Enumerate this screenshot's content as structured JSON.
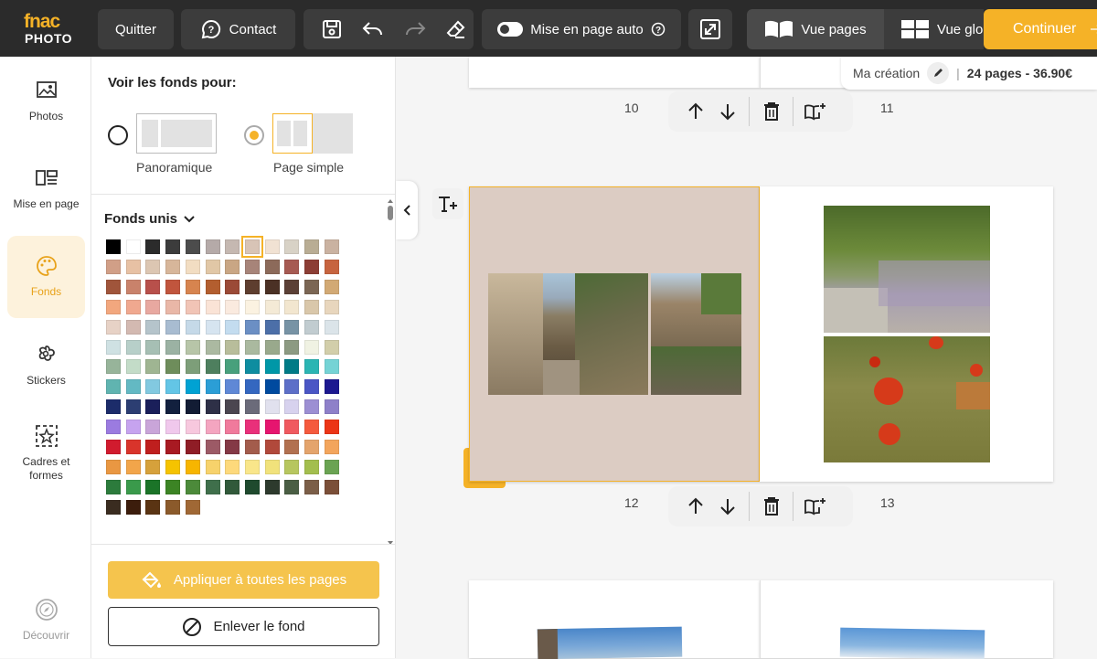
{
  "topbar": {
    "logo_top": "fnac",
    "logo_bottom": "PHOTO",
    "quit_label": "Quitter",
    "contact_label": "Contact",
    "auto_layout_label": "Mise en page auto",
    "view_pages_label": "Vue pages",
    "view_global_label": "Vue glo",
    "continue_label": "Continuer"
  },
  "creation": {
    "name": "Ma création",
    "summary": "24 pages - 36.90€"
  },
  "rail": {
    "items": [
      {
        "label": "Photos",
        "icon": "image-icon"
      },
      {
        "label": "Mise en page",
        "icon": "layout-icon"
      },
      {
        "label": "Fonds",
        "icon": "palette-icon",
        "active": true
      },
      {
        "label": "Stickers",
        "icon": "sticker-icon"
      },
      {
        "label": "Cadres et formes",
        "icon": "frame-icon"
      },
      {
        "label": "Découvrir",
        "icon": "compass-icon"
      }
    ]
  },
  "panel": {
    "heading": "Voir les fonds pour:",
    "option_panoramic": "Panoramique",
    "option_single": "Page simple",
    "selected_option": "Page simple",
    "section_title": "Fonds unis",
    "apply_all_label": "Appliquer à toutes les pages",
    "remove_label": "Enlever le fond",
    "selected_swatch": "#d8c4b6",
    "swatch_rows": [
      [
        "#000000",
        "#ffffff",
        "#2b2b2b",
        "#3c3c3c",
        "#4c4c4c",
        "#b5aaa8",
        "#c5b8b1",
        "#d8c4b6",
        "#f1e2d3",
        "#d8d2c6",
        "#b9ad94",
        "#cab2a1"
      ],
      [
        "#d19f87",
        "#e7c1a4",
        "#dcc6b2",
        "#d7b69a",
        "#f2ddc2",
        "#e1c7a6",
        "#c9a684",
        "#a78479",
        "#8c6a5a",
        "#a65a52",
        "#8c3e35",
        "#c7643f"
      ],
      [
        "#a0553b",
        "#c9826b",
        "#b8504b",
        "#c1553d",
        "#d7844f",
        "#b35e2f",
        "#9b4a37",
        "#5e3e2f",
        "#4b3125",
        "#5b4036",
        "#7b6654",
        "#d2a974"
      ],
      [
        "#f2a77e",
        "#f0a88f",
        "#e8a8a0",
        "#e9b7a7",
        "#f1c4b6",
        "#fae3d6",
        "#faeadf",
        "#fbf2e1",
        "#f4ead6",
        "#f2e6cf",
        "#d9c7aa",
        "#e8d6bd"
      ],
      [
        "#e7d2c6",
        "#d3b9b1",
        "#b5c4cb",
        "#a8bcd1",
        "#c5d9e8",
        "#d6e4f0",
        "#c3dcef",
        "#6b8fc4",
        "#4c6fa8",
        "#7793a5",
        "#c1ccd0",
        "#dbe4e9"
      ],
      [
        "#cfe1e3",
        "#b7cfc9",
        "#a6bfb4",
        "#9bb2a3",
        "#b7c5a8",
        "#abb9a1",
        "#b8bd9b",
        "#aab99f",
        "#99a98c",
        "#8c9a82",
        "#f0f2e3",
        "#d2ceaa"
      ],
      [
        "#97b49a",
        "#c3dcc8",
        "#9fb592",
        "#6e8d5b",
        "#7d9e79",
        "#4e7f5e",
        "#48a07c",
        "#0e8da0",
        "#0097a7",
        "#007b86",
        "#2bb5b3",
        "#75d3d5"
      ],
      [
        "#60b4b0",
        "#63b9c3",
        "#82c9e0",
        "#63c5e6",
        "#00a2d3",
        "#2b9ed6",
        "#5f88d6",
        "#3467c0",
        "#004a9f",
        "#5d6fc8",
        "#4a56c5",
        "#1c1890"
      ],
      [
        "#1c2c6a",
        "#2c3e72",
        "#1a1f5a",
        "#12203e",
        "#121c34",
        "#2e3047",
        "#4b4650",
        "#6b6b7a",
        "#e1e1ee",
        "#d7d2ee",
        "#9c8fd3",
        "#8e80c9"
      ],
      [
        "#9b7be0",
        "#c6a3ef",
        "#c9a5d9",
        "#f0c8ec",
        "#f7c8de",
        "#f4a5c0",
        "#f07a9c",
        "#e9307a",
        "#e6156f",
        "#f0595f",
        "#f55a3d",
        "#ec3516"
      ],
      [
        "#d11b2e",
        "#d9342b",
        "#bf1f1e",
        "#a81a22",
        "#8f1d26",
        "#9c5a66",
        "#843946",
        "#a35c4c",
        "#b1493b",
        "#b27150",
        "#e4a46c",
        "#f3a55c"
      ],
      [
        "#e99742",
        "#f2a54a",
        "#d6a13b",
        "#f5c300",
        "#f7b500",
        "#f7d26b",
        "#fdd97b",
        "#f9e68a",
        "#f1e27b",
        "#b7c65f",
        "#a3be4e",
        "#6aa352"
      ],
      [
        "#2c7b3c",
        "#3a9a4b",
        "#1b7428",
        "#3c8424",
        "#4c8a3a",
        "#3f6f4b",
        "#31593a",
        "#1f4a2e",
        "#2d3a2d",
        "#4a5e44",
        "#7b5e48",
        "#7b4f38"
      ],
      [
        "#3a2c20",
        "#3c1d0c",
        "#5a3413",
        "#8b5a2b",
        "#a06835"
      ]
    ]
  },
  "pages": {
    "top_left_num": "10",
    "top_right_num": "11",
    "mid_left_num": "12",
    "mid_right_num": "13"
  },
  "colors": {
    "accent": "#f5b227",
    "topbar": "#2b2b2b",
    "spread_bg": "#dcccc3"
  }
}
